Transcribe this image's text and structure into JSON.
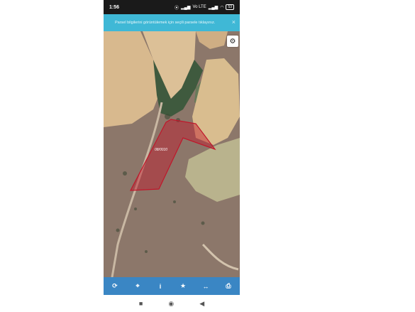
{
  "status_bar": {
    "time": "1:56",
    "icons": [
      "record-icon",
      "signal-icon",
      "volte-icon",
      "signal-icon",
      "wifi-icon"
    ],
    "volte_text": "Vo LTE",
    "battery": "53"
  },
  "toast": {
    "message": "Parsel bilgilerini görüntülemek için seçili parsele tıklayınız.",
    "close": "×"
  },
  "map": {
    "parcel_label": "08/0010",
    "settings_icon": "gear-icon",
    "parcel_color": "#c0162a"
  },
  "toolbar": {
    "items": [
      {
        "icon": "refresh-icon",
        "glyph": "⟳"
      },
      {
        "icon": "locate-icon",
        "glyph": "⌖"
      },
      {
        "icon": "info-icon",
        "glyph": "i"
      },
      {
        "icon": "star-icon",
        "glyph": "★"
      },
      {
        "icon": "measure-icon",
        "glyph": "↔"
      },
      {
        "icon": "print-icon",
        "glyph": "⎙"
      }
    ],
    "color": "#3a86c4"
  },
  "navbar": {
    "items": [
      {
        "icon": "square-icon",
        "glyph": "■"
      },
      {
        "icon": "circle-icon",
        "glyph": "◉"
      },
      {
        "icon": "back-icon",
        "glyph": "◀"
      }
    ]
  }
}
